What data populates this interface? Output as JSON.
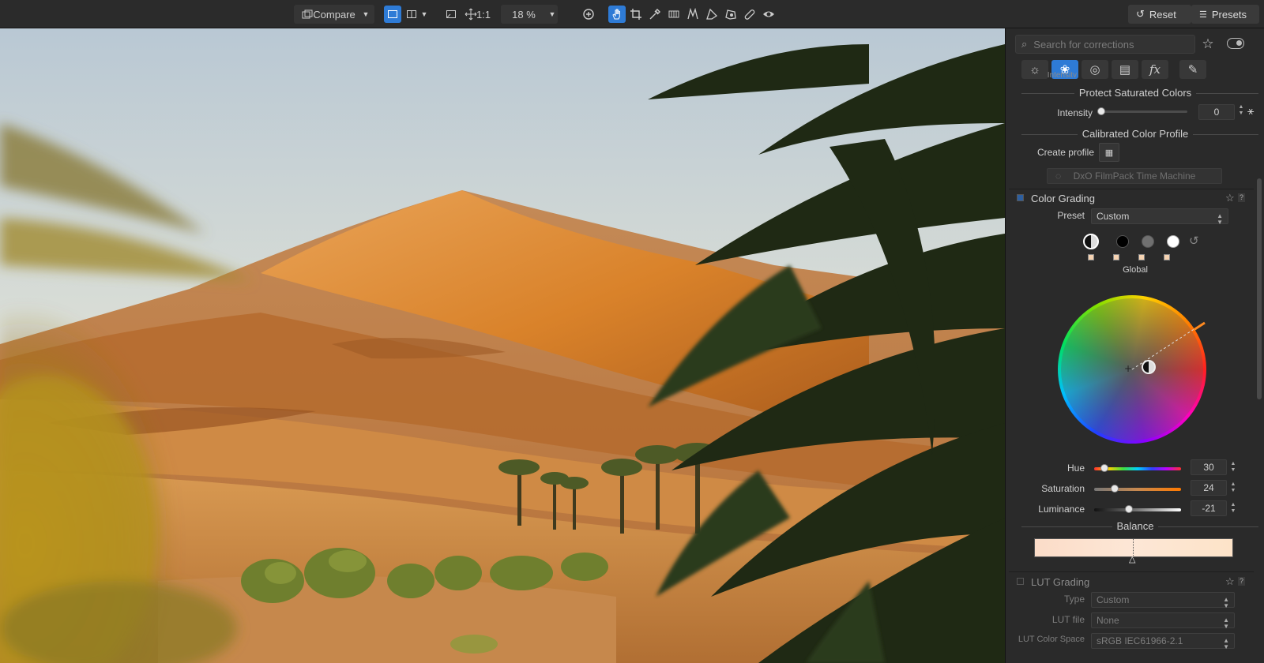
{
  "toolbar": {
    "compare_label": "Compare",
    "one_to_one_label": "1:1",
    "zoom_value": "18 %",
    "reset_label": "Reset",
    "presets_label": "Presets"
  },
  "panel": {
    "search_placeholder": "Search for corrections",
    "intensity_top_partial": "Intensity",
    "protect_title": "Protect Saturated Colors",
    "protect_intensity_label": "Intensity",
    "protect_intensity_value": "0",
    "calibrated_title": "Calibrated Color Profile",
    "create_profile_label": "Create profile",
    "filmpack_button": "DxO FilmPack Time Machine",
    "color_grading": {
      "title": "Color Grading",
      "preset_label": "Preset",
      "preset_value": "Custom",
      "range_label": "Global",
      "hue_label": "Hue",
      "hue_value": "30",
      "hue_level": 0.12,
      "saturation_label": "Saturation",
      "saturation_value": "24",
      "saturation_level": 0.24,
      "luminance_label": "Luminance",
      "luminance_value": "-21",
      "luminance_level": 0.4,
      "balance_label": "Balance"
    },
    "lut_grading": {
      "title": "LUT Grading",
      "type_label": "Type",
      "type_value": "Custom",
      "lut_file_label": "LUT file",
      "lut_file_value": "None",
      "color_space_label": "LUT Color Space",
      "color_space_value": "sRGB IEC61966-2.1"
    }
  },
  "colors": {
    "accent": "#2e7bd6",
    "panel_bg": "#2a2a2a",
    "toolbar_bg": "#2b2b2b"
  }
}
